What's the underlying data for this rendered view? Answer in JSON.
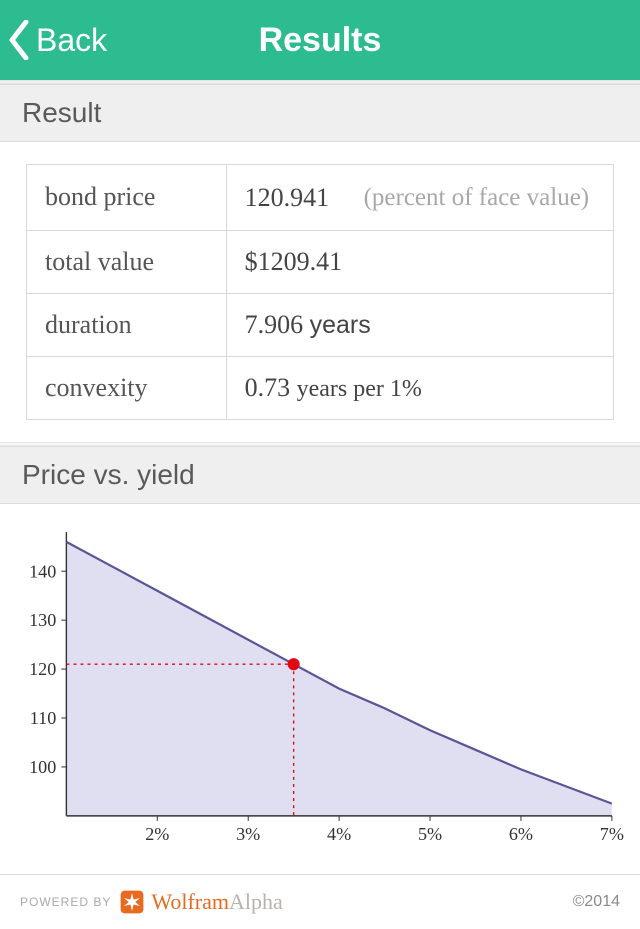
{
  "nav": {
    "back_label": "Back",
    "title": "Results"
  },
  "sections": {
    "result": "Result",
    "chart": "Price vs. yield"
  },
  "result": {
    "rows": [
      {
        "label": "bond price",
        "value": "120.941",
        "annotation": "(percent of face value)"
      },
      {
        "label": "total value",
        "value": "$1209.41"
      },
      {
        "label": "duration",
        "value": "7.906",
        "unit": "years",
        "unit_style": "sans"
      },
      {
        "label": "convexity",
        "value": "0.73",
        "unit": "years per 1%",
        "unit_style": "serif"
      }
    ]
  },
  "chart_data": {
    "type": "line",
    "title": "",
    "xlabel": "",
    "ylabel": "",
    "x": [
      0.01,
      0.015,
      0.02,
      0.025,
      0.03,
      0.035,
      0.04,
      0.045,
      0.05,
      0.055,
      0.06,
      0.065,
      0.07
    ],
    "y": [
      146,
      141,
      136,
      131,
      126,
      121,
      116,
      112,
      107.5,
      103.5,
      99.5,
      96,
      92.5
    ],
    "x_ticks": [
      "2%",
      "3%",
      "4%",
      "5%",
      "6%",
      "7%"
    ],
    "y_ticks": [
      100,
      110,
      120,
      130,
      140
    ],
    "xlim": [
      0.01,
      0.07
    ],
    "ylim": [
      90,
      148
    ],
    "marker": {
      "x": 0.035,
      "y": 121
    },
    "fill_color": "#d6d4ee",
    "line_color": "#5a5596",
    "marker_color": "#e30613"
  },
  "footer": {
    "powered_by": "POWERED BY",
    "brand1": "Wolfram",
    "brand2": "Alpha",
    "copyright": "©2014"
  }
}
